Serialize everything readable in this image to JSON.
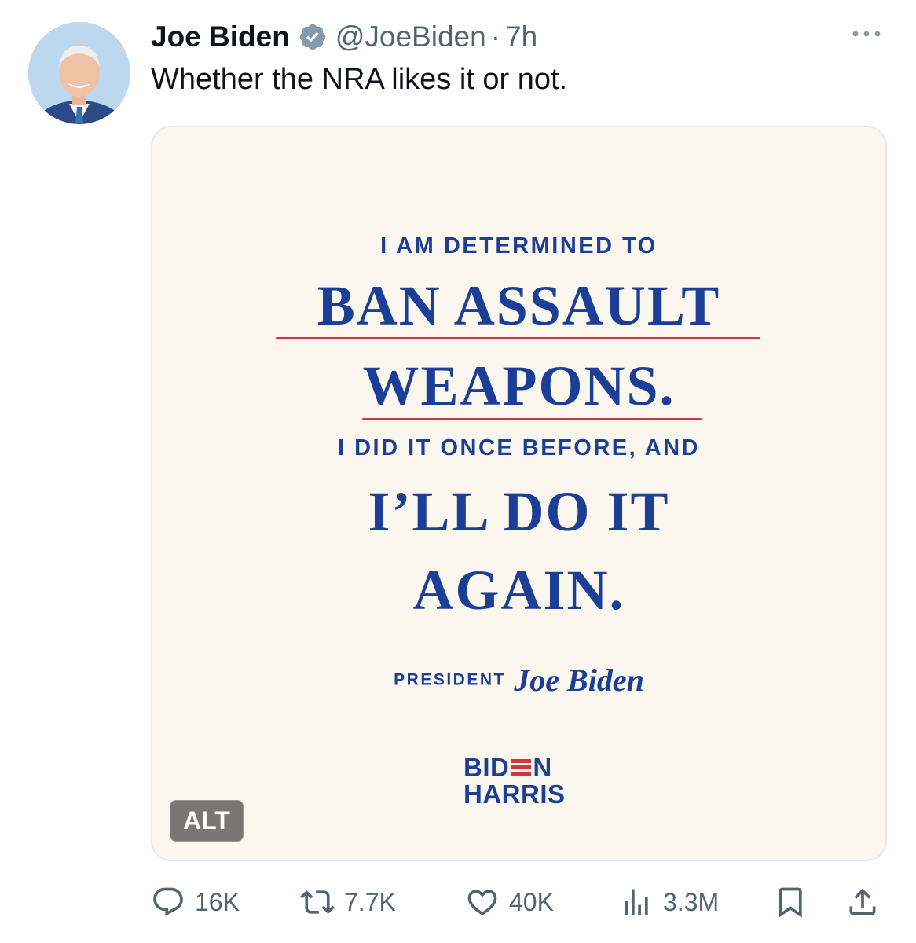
{
  "author": {
    "name": "Joe Biden",
    "handle": "@JoeBiden",
    "separator": "·",
    "time": "7h",
    "verified": true,
    "verified_color": "#829aab"
  },
  "tweet": {
    "text": "Whether the NRA likes it or not."
  },
  "media": {
    "line1": "I AM DETERMINED TO",
    "line2": "BAN ASSAULT",
    "line3": "WEAPONS.",
    "line4": "I DID IT ONCE BEFORE, AND",
    "line5": "I’LL DO IT",
    "line6": "AGAIN.",
    "signature_label": "PRESIDENT",
    "signature_name": "Joe Biden",
    "logo_top_a": "BID",
    "logo_top_b": "N",
    "logo_bottom": "HARRIS",
    "alt_label": "ALT",
    "text_color": "#1b3e96",
    "accent_color": "#d3343d",
    "background": "#fcf7ee"
  },
  "actions": {
    "replies": "16K",
    "reposts": "7.7K",
    "likes": "40K",
    "views": "3.3M"
  },
  "icons": {
    "reply": "reply-icon",
    "repost": "repost-icon",
    "like": "heart-icon",
    "views": "views-chart-icon",
    "bookmark": "bookmark-icon",
    "share": "share-icon",
    "more": "more-icon"
  }
}
